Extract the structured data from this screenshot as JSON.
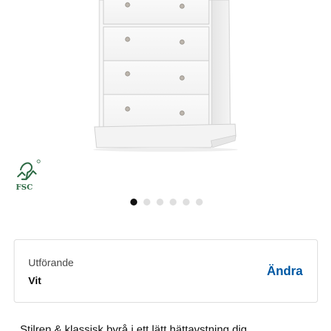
{
  "product": {
    "image_icon": "white-chest-of-drawers",
    "drawer_count_visible": 4
  },
  "certification": {
    "icon": "fsc-tree-checkmark-icon",
    "label": "FSC",
    "color": "#2e6b45"
  },
  "carousel": {
    "total": 6,
    "active_index": 0
  },
  "variant": {
    "label": "Utförande",
    "value": "Vit",
    "action_label": "Ändra",
    "action_color": "#0058a3"
  },
  "description": {
    "text": "Stilren & klassisk byrå i ett lätt hättavstning dig"
  }
}
